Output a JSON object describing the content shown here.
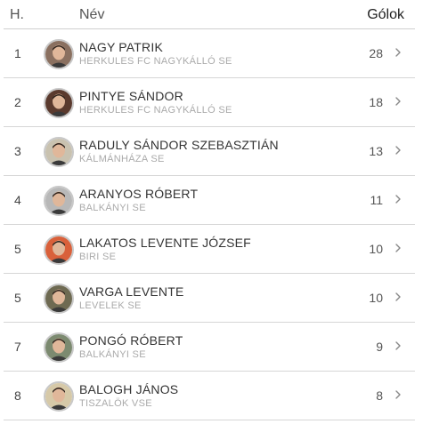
{
  "header": {
    "rank_label": "H.",
    "name_label": "Név",
    "goals_label": "Gólok"
  },
  "rows": [
    {
      "rank": "1",
      "name": "NAGY PATRIK",
      "club": "HERKULES FC NAGYKÁLLÓ SE",
      "goals": "28",
      "avatar_bg": "#8a7060"
    },
    {
      "rank": "2",
      "name": "PINTYE SÁNDOR",
      "club": "HERKULES FC NAGYKÁLLÓ SE",
      "goals": "18",
      "avatar_bg": "#5a3a2e"
    },
    {
      "rank": "3",
      "name": "RADULY SÁNDOR SZEBASZTIÁN",
      "club": "KÁLMÁNHÁZA SE",
      "goals": "13",
      "avatar_bg": "#c9c2b0"
    },
    {
      "rank": "4",
      "name": "ARANYOS RÓBERT",
      "club": "BALKÁNYI SE",
      "goals": "11",
      "avatar_bg": "#b8b8b8"
    },
    {
      "rank": "5",
      "name": "LAKATOS LEVENTE JÓZSEF",
      "club": "BIRI SE",
      "goals": "10",
      "avatar_bg": "#d9603a"
    },
    {
      "rank": "5",
      "name": "VARGA LEVENTE",
      "club": "LEVELEK SE",
      "goals": "10",
      "avatar_bg": "#6e6a52"
    },
    {
      "rank": "7",
      "name": "PONGÓ RÓBERT",
      "club": "BALKÁNYI SE",
      "goals": "9",
      "avatar_bg": "#7c8a70"
    },
    {
      "rank": "8",
      "name": "BALOGH JÁNOS",
      "club": "TISZALÖK VSE",
      "goals": "8",
      "avatar_bg": "#d6c9a8"
    }
  ],
  "icons": {
    "row_action": "chevron-right-icon",
    "avatar": "player-photo"
  }
}
